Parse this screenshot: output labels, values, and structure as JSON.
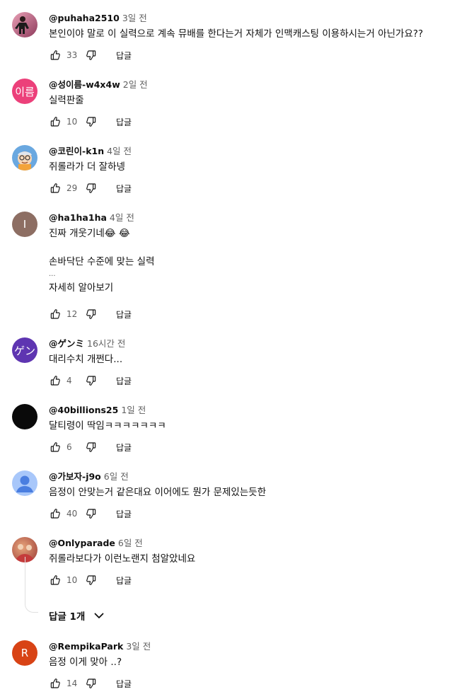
{
  "comments": [
    {
      "author": "@puhaha2510",
      "time": "3일 전",
      "lines": [
        "본인이야 말로 이 실력으로 계속 뮤배를 한다는거 자체가 인맥캐스팅 이용하시는거 아닌가요??"
      ],
      "likes": "33",
      "reply_label": "답글",
      "avatar": {
        "type": "photo",
        "color": "#b84a6a"
      }
    },
    {
      "author": "@성이름-w4x4w",
      "time": "2일 전",
      "lines": [
        "실력판줄"
      ],
      "likes": "10",
      "reply_label": "답글",
      "avatar": {
        "type": "letter",
        "letter": "이름",
        "color": "#ec407a"
      }
    },
    {
      "author": "@코린이-k1n",
      "time": "4일 전",
      "lines": [
        "쥐롤라가 더 잘하넹"
      ],
      "likes": "29",
      "reply_label": "답글",
      "avatar": {
        "type": "cartoon",
        "color": "#6aa8e0"
      }
    },
    {
      "author": "@ha1ha1ha",
      "time": "4일 전",
      "lines": [
        "진짜 개웃기네😂 😂",
        "",
        "손바닥단 수준에 맞는 실력"
      ],
      "ellipsis": "...",
      "more_label": "자세히 알아보기",
      "likes": "12",
      "reply_label": "답글",
      "avatar": {
        "type": "letter",
        "letter": "I",
        "color": "#8d6e63"
      }
    },
    {
      "author": "@ゲンミ",
      "time": "16시간 전",
      "lines": [
        "대리수치 개쩐다..."
      ],
      "likes": "4",
      "reply_label": "답글",
      "avatar": {
        "type": "letter",
        "letter": "ゲン",
        "color": "#5e35b1"
      }
    },
    {
      "author": "@40billions25",
      "time": "1일 전",
      "lines": [
        "달티령이 딱임ㅋㅋㅋㅋㅋㅋㅋ"
      ],
      "likes": "6",
      "reply_label": "답글",
      "avatar": {
        "type": "solid",
        "color": "#0a0a0a"
      }
    },
    {
      "author": "@가보자-j9o",
      "time": "6일 전",
      "lines": [
        "음정이 안맞는거 같은대요 이어에도 뭔가 문제있는듯한"
      ],
      "likes": "40",
      "reply_label": "답글",
      "avatar": {
        "type": "default",
        "color": "#a8c7fa"
      }
    },
    {
      "author": "@Onlyparade",
      "time": "6일 전",
      "lines": [
        "쥐롤라보다가 이런노랜지 첨알았네요"
      ],
      "likes": "10",
      "reply_label": "답글",
      "avatar": {
        "type": "photo2",
        "color": "#c0504d"
      }
    },
    {
      "author": "@RempikaPark",
      "time": "3일 전",
      "lines": [
        "음정 이게 맞아 ..?"
      ],
      "likes": "14",
      "reply_label": "답글",
      "avatar": {
        "type": "letter",
        "letter": "R",
        "color": "#d84315"
      }
    }
  ],
  "replies_toggle": {
    "label": "답글 1개"
  },
  "icons": {
    "like": "thumbs-up-icon",
    "dislike": "thumbs-down-icon",
    "expand": "chevron-down-icon"
  }
}
